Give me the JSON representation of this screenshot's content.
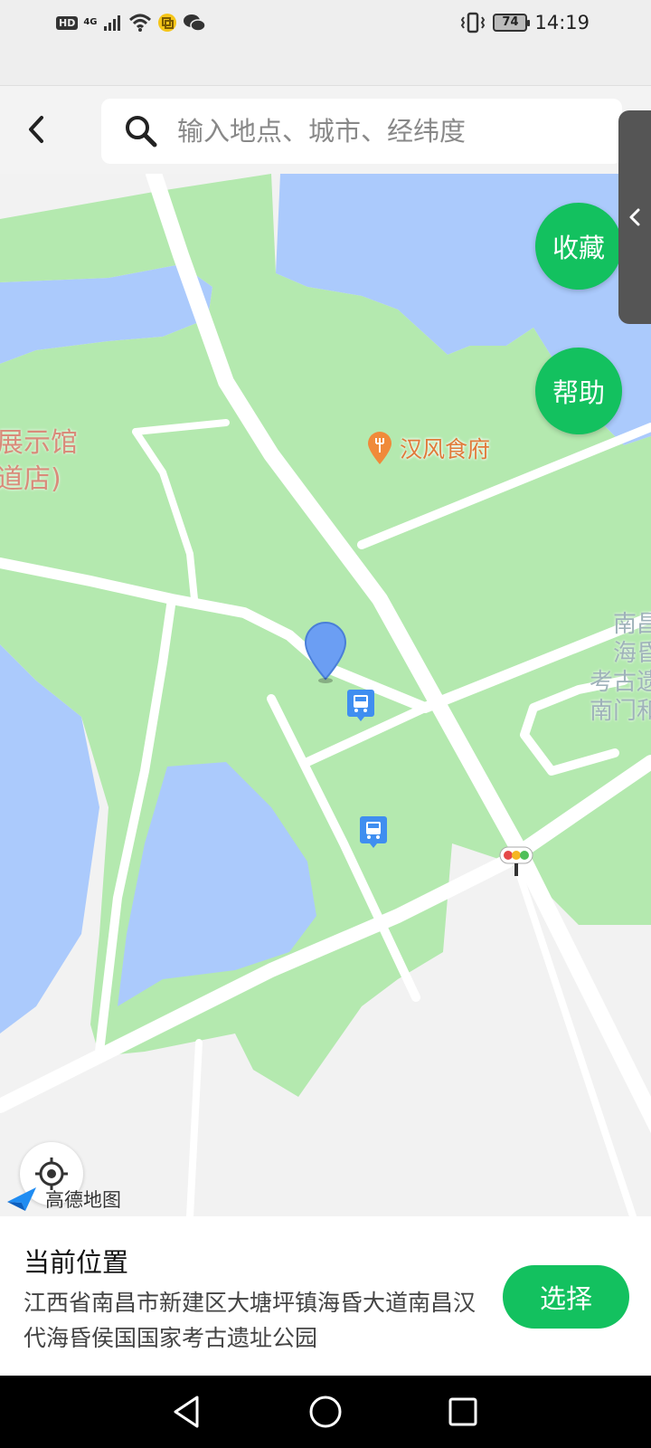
{
  "status_bar": {
    "hd": "HD",
    "network": "4G",
    "battery": "74",
    "time": "14:19"
  },
  "header": {
    "back_icon": "chevron-left-icon",
    "search_icon": "search-icon",
    "search_placeholder": "输入地点、城市、经纬度",
    "search_value": ""
  },
  "map": {
    "favorites_button": "收藏",
    "help_button": "帮助",
    "poi_restaurant": "汉风食府",
    "label_left_line1": "展示馆",
    "label_left_line2": "道店)",
    "label_right_line1": "南昌",
    "label_right_line2": "海昏",
    "label_right_line3": "考古遗",
    "label_right_line4": "南门和",
    "logo_text": "高德地图",
    "colors": {
      "park": "#b4e9af",
      "water": "#abcafc",
      "road": "#ffffff",
      "accent": "#13c15f"
    }
  },
  "bottom_panel": {
    "title": "当前位置",
    "address": "江西省南昌市新建区大塘坪镇海昏大道南昌汉代海昏侯国国家考古遗址公园",
    "select_button": "选择"
  },
  "nav_bar": {
    "back_icon": "triangle-back-icon",
    "home_icon": "circle-home-icon",
    "recents_icon": "square-recents-icon"
  }
}
